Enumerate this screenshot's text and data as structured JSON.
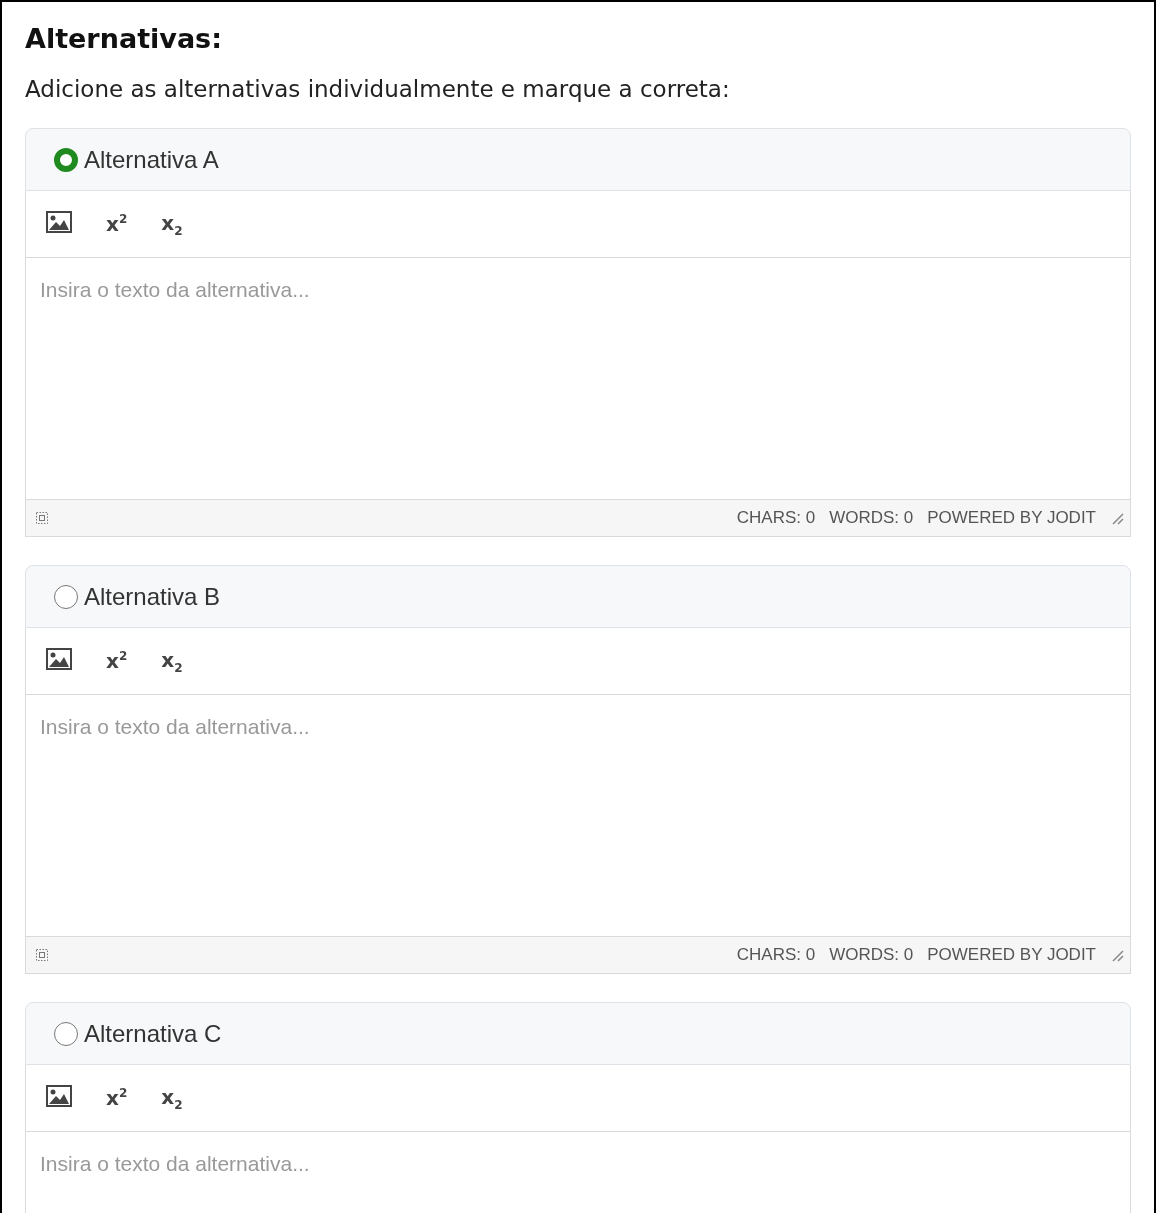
{
  "title": "Alternativas:",
  "instruction": "Adicione as alternativas individualmente e marque a correta:",
  "alternatives": [
    {
      "label": "Alternativa A",
      "selected": true,
      "toolbar": [
        "x$^{2}$",
        "x$_{2}$"
      ],
      "placeholder": "Insira o texto da alternativa...",
      "status": [
        "CHARS: 0",
        "WORDS: 0",
        "POWERED BY JODIT"
      ]
    },
    {
      "label": "Alternativa B",
      "selected": false,
      "toolbar": [
        "x$^{2}$",
        "x$_{2}$"
      ],
      "placeholder": "Insira o texto da alternativa...",
      "status": [
        "CHARS: 0",
        "WORDS: 0",
        "POWERED BY JODIT"
      ]
    },
    {
      "label": "Alternativa C",
      "selected": false,
      "toolbar": [
        "x$^{2}$",
        "x$_{2}$"
      ],
      "placeholder": "Insira o texto da alternativa..."
    }
  ]
}
